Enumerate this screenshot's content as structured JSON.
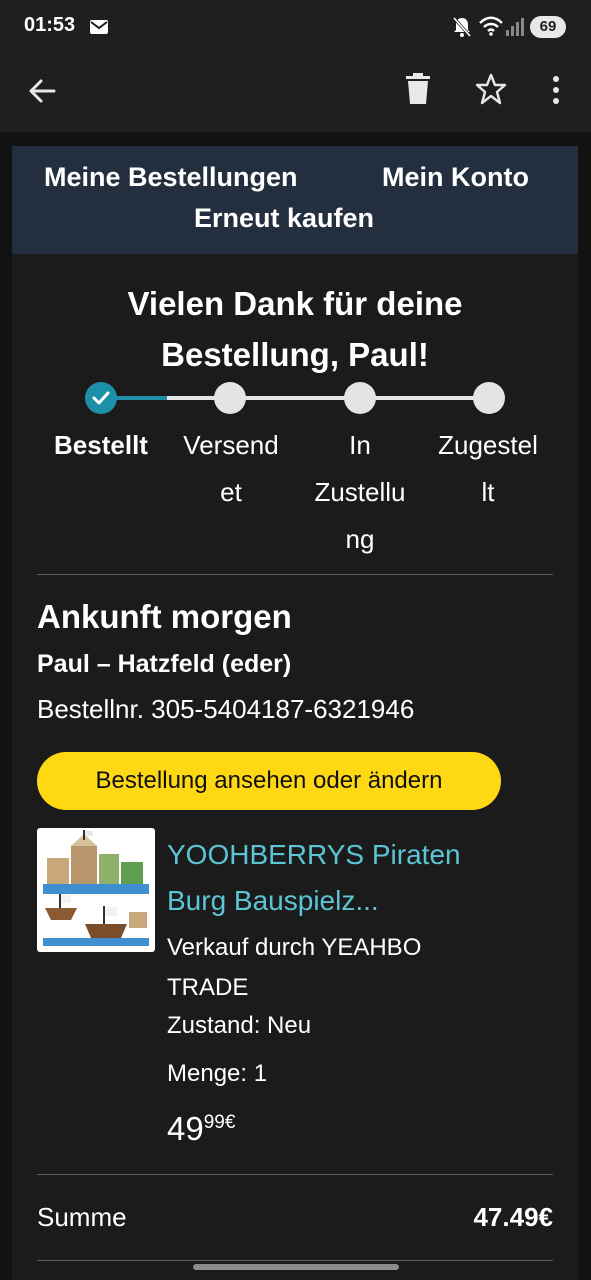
{
  "status_bar": {
    "time": "01:53",
    "battery": "69",
    "icons": [
      "mail-icon",
      "mute-icon",
      "wifi-icon",
      "signal-icon",
      "battery-icon"
    ]
  },
  "app_bar": {
    "icons": [
      "back-arrow-icon",
      "trash-icon",
      "star-icon",
      "more-vert-icon"
    ]
  },
  "nav": {
    "orders": "Meine Bestellungen",
    "account": "Mein Konto",
    "rebuy": "Erneut kaufen"
  },
  "thanks_line1": "Vielen Dank für deine",
  "thanks_line2": "Bestellung, Paul!",
  "tracker": {
    "steps": [
      {
        "label_lines": [
          "Bestellt"
        ],
        "done": true
      },
      {
        "label_lines": [
          "Versend",
          "et"
        ],
        "done": false
      },
      {
        "label_lines": [
          "In",
          "Zustellu",
          "ng"
        ],
        "done": false
      },
      {
        "label_lines": [
          "Zugestel",
          "lt"
        ],
        "done": false
      }
    ],
    "active_color": "#1d8fa8",
    "inactive_color": "#e4e4e4"
  },
  "shipment": {
    "arrival": "Ankunft morgen",
    "recipient": "Paul – Hatzfeld (eder)",
    "order_number": "Bestellnr. 305-5404187-6321946",
    "cta": "Bestellung ansehen oder ändern",
    "cta_color": "#ffd814"
  },
  "product": {
    "title_line1": "YOOHBERRYS Piraten",
    "title_line2": "Burg Bauspielz...",
    "seller_line1": "Verkauf durch YEAHBO",
    "seller_line2": "TRADE",
    "condition": "Zustand: Neu",
    "quantity": "Menge: 1",
    "price_main": "49",
    "price_fraction": "99€",
    "link_color": "#5bc5d6"
  },
  "summary": {
    "label": "Summe",
    "value": "47.49€"
  }
}
